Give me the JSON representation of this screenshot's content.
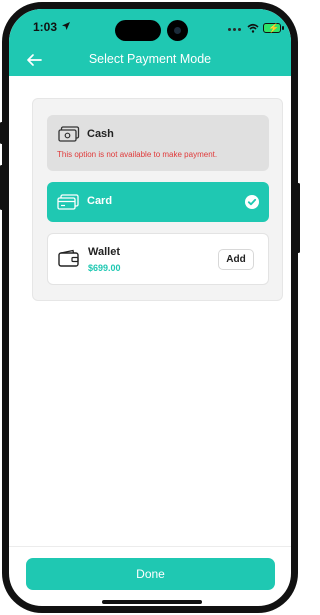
{
  "status_bar": {
    "time": "1:03"
  },
  "header": {
    "title": "Select Payment Mode"
  },
  "payment_options": {
    "cash": {
      "label": "Cash",
      "note": "This option is not available to make payment."
    },
    "card": {
      "label": "Card",
      "selected": true
    },
    "wallet": {
      "label": "Wallet",
      "balance": "$699.00",
      "add_label": "Add"
    }
  },
  "footer": {
    "done_label": "Done"
  },
  "colors": {
    "accent": "#1fc8b2",
    "error": "#e03a3a",
    "disabled_bg": "#e0e0e0"
  },
  "icons": [
    "location-arrow-icon",
    "wifi-icon",
    "battery-icon",
    "back-arrow-icon",
    "cash-icon",
    "card-icon",
    "check-circle-icon",
    "wallet-icon"
  ]
}
